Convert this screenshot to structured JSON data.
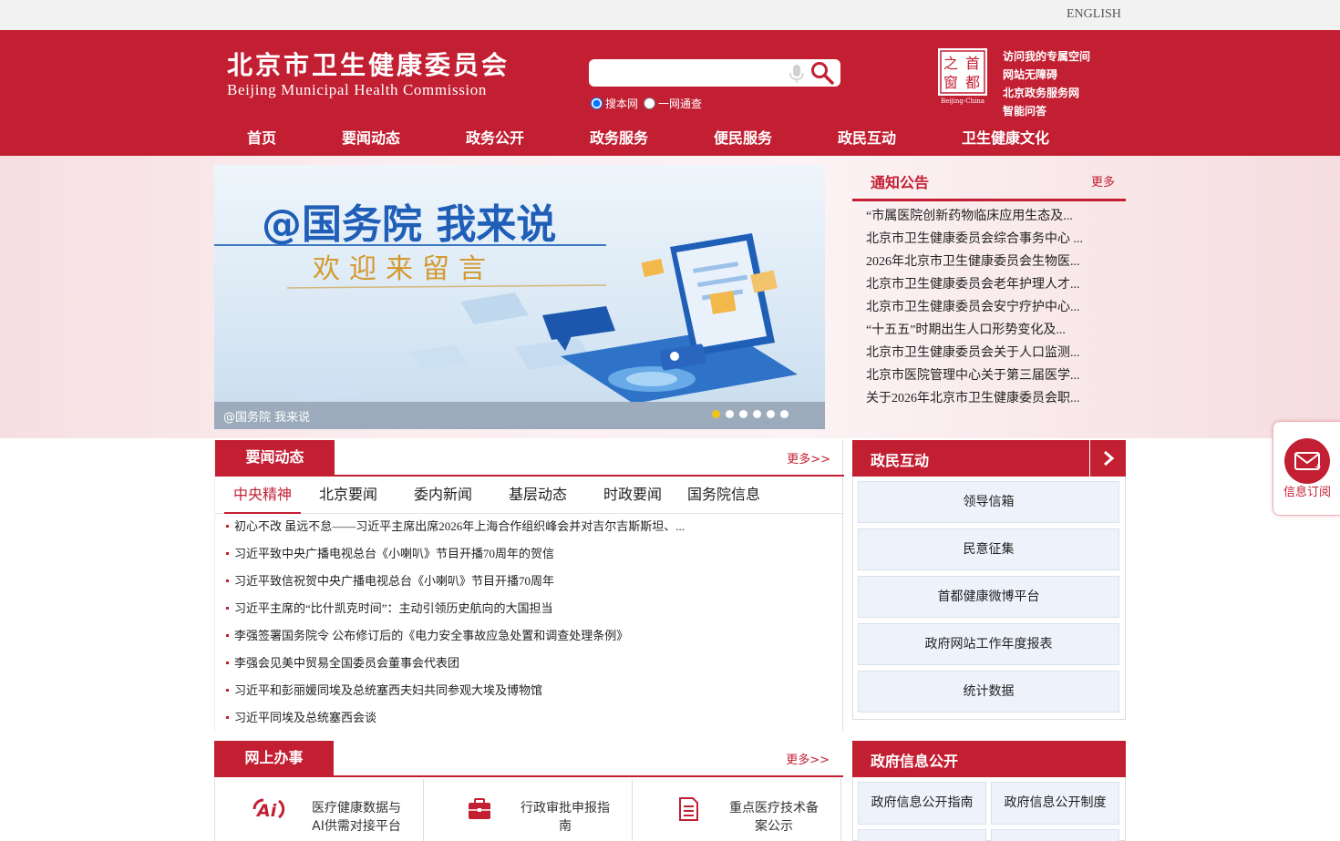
{
  "topbar": {
    "english": "ENGLISH"
  },
  "header": {
    "logo_cn": "北京市卫生健康委员会",
    "logo_en": "Beijing Municipal Health Commission",
    "search": {
      "value": "",
      "placeholder": ""
    },
    "radio_options": [
      "搜本网",
      "一网通查"
    ],
    "seal": {
      "char1": "首",
      "char2": "之",
      "char3": "都",
      "char4": "窗",
      "caption": "Beijing-China"
    },
    "quick_links": [
      "访问我的专属空间",
      "网站无障碍",
      "北京政务服务网",
      "智能问答"
    ]
  },
  "nav": [
    "首页",
    "要闻动态",
    "政务公开",
    "政务服务",
    "便民服务",
    "政民互动",
    "卫生健康文化"
  ],
  "banner": {
    "headline": "@国务院 我来说",
    "subline": "欢迎来留言",
    "caption": "@国务院 我来说",
    "slide_count": 6,
    "active_slide": 1
  },
  "notice": {
    "title": "通知公告",
    "more": "更多",
    "items": [
      "“市属医院创新药物临床应用生态及...",
      "北京市卫生健康委员会综合事务中心 ...",
      "2026年北京市卫生健康委员会生物医...",
      "北京市卫生健康委员会老年护理人才...",
      "北京市卫生健康委员会安宁疗护中心...",
      "“十五五”时期出生人口形势变化及...",
      "北京市卫生健康委员会关于人口监测...",
      "北京市医院管理中心关于第三届医学...",
      "关于2026年北京市卫生健康委员会职..."
    ]
  },
  "news": {
    "title": "要闻动态",
    "more": "更多>>",
    "tabs": [
      "中央精神",
      "北京要闻",
      "委内新闻",
      "基层动态",
      "时政要闻",
      "国务院信息"
    ],
    "items": [
      "初心不改 虽远不怠——习近平主席出席2026年上海合作组织峰会并对吉尔吉斯斯坦、...",
      "习近平致中央广播电视总台《小喇叭》节目开播70周年的贺信",
      "习近平致信祝贺中央广播电视总台《小喇叭》节目开播70周年",
      "习近平主席的“比什凯克时间”：主动引领历史航向的大国担当",
      "李强签署国务院令 公布修订后的《电力安全事故应急处置和调查处理条例》",
      "李强会见美中贸易全国委员会董事会代表团",
      "习近平和彭丽媛同埃及总统塞西夫妇共同参观大埃及博物馆",
      "习近平同埃及总统塞西会谈"
    ]
  },
  "interaction": {
    "title": "政民互动",
    "buttons": [
      "领导信箱",
      "民意征集",
      "首都健康微博平台",
      "政府网站工作年度报表",
      "统计数据"
    ]
  },
  "online": {
    "title": "网上办事",
    "more": "更多>>",
    "services": [
      {
        "icon": "ai-icon",
        "label": "医疗健康数据与AI供需对接平台"
      },
      {
        "icon": "briefcase-icon",
        "label": "行政审批申报指南"
      },
      {
        "icon": "document-icon",
        "label": "重点医疗技术备案公示"
      }
    ]
  },
  "gov_info": {
    "title": "政府信息公开",
    "buttons": [
      "政府信息公开指南",
      "政府信息公开制度"
    ]
  },
  "subscribe": {
    "label": "信息订阅"
  },
  "colors": {
    "brand_red": "#c31f33",
    "tile_blue": "#eef3fb",
    "dot_active": "#f0c21a"
  }
}
